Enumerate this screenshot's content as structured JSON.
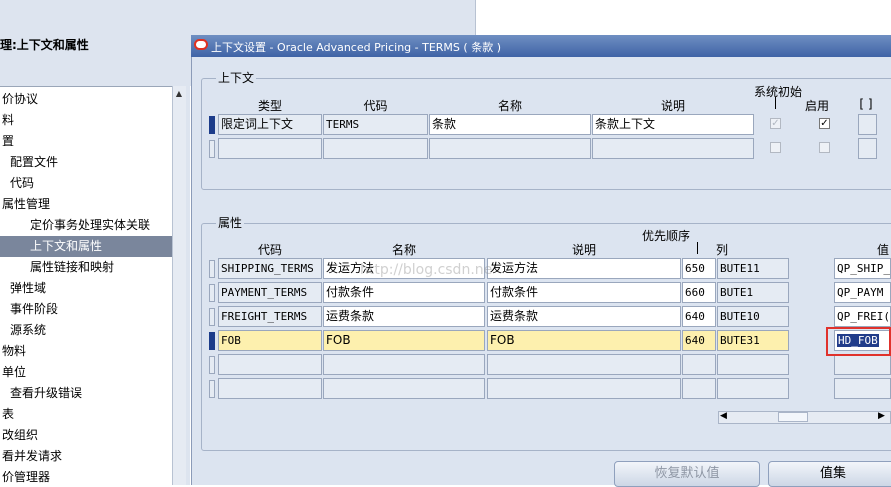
{
  "navigator": {
    "title": "理:上下文和属性",
    "items": [
      {
        "label": "价协议",
        "indent": 0
      },
      {
        "label": "料",
        "indent": 0
      },
      {
        "label": "置",
        "indent": 0
      },
      {
        "label": "配置文件",
        "indent": 1
      },
      {
        "label": "代码",
        "indent": 1
      },
      {
        "label": "属性管理",
        "indent": 0
      },
      {
        "label": "定价事务处理实体关联",
        "indent": 2
      },
      {
        "label": "上下文和属性",
        "indent": 2,
        "selected": true
      },
      {
        "label": "属性链接和映射",
        "indent": 2
      },
      {
        "label": "弹性域",
        "indent": 1
      },
      {
        "label": "事件阶段",
        "indent": 1
      },
      {
        "label": "源系统",
        "indent": 1
      },
      {
        "label": "物料",
        "indent": 0
      },
      {
        "label": "单位",
        "indent": 0
      },
      {
        "label": "查看升级错误",
        "indent": 1
      },
      {
        "label": "表",
        "indent": 0
      },
      {
        "label": "改组织",
        "indent": 0
      },
      {
        "label": "看并发请求",
        "indent": 0
      },
      {
        "label": "价管理器",
        "indent": 0
      }
    ]
  },
  "window": {
    "title": "上下文设置 - Oracle Advanced Pricing - TERMS ( 条款 )",
    "icon": "oracle-logo-icon"
  },
  "context": {
    "label": "上下文",
    "headers": {
      "type": "类型",
      "code": "代码",
      "name": "名称",
      "description": "说明",
      "system_init": "系统初始",
      "enabled": "启用",
      "bracket": "[ ]"
    },
    "row": {
      "type": "限定词上下文",
      "code": "TERMS",
      "name": "条款",
      "description": "条款上下文",
      "system_init_checked": true,
      "enabled_checked": true
    }
  },
  "attributes": {
    "label": "属性",
    "headers": {
      "code": "代码",
      "name": "名称",
      "description": "说明",
      "priority": "优先顺序",
      "attr_partial": "列",
      "value_partial": "值"
    },
    "rows": [
      {
        "code": "SHIPPING_TERMS",
        "name": "发运方法",
        "description": "发运方法",
        "priority": "650",
        "column": "BUTE11",
        "value": "QP_SHIP_"
      },
      {
        "code": "PAYMENT_TERMS",
        "name": "付款条件",
        "description": "付款条件",
        "priority": "660",
        "column": "BUTE1",
        "value": "QP_PAYM"
      },
      {
        "code": "FREIGHT_TERMS",
        "name": "运费条款",
        "description": "运费条款",
        "priority": "640",
        "column": "BUTE10",
        "value": "QP_FREI("
      },
      {
        "code": "FOB",
        "name": "FOB",
        "description": "FOB",
        "priority": "640",
        "column": "BUTE31",
        "value": "HD_FOB"
      }
    ]
  },
  "buttons": {
    "restore_defaults": "恢复默认值",
    "value_set": "值集"
  },
  "watermark": "http://blog.csdn.ne",
  "colors": {
    "title_bar": "#3f63a6",
    "highlight_row": "#fdf0ae",
    "selection_box": "#e0322c",
    "selected_nav": "#7a869c"
  }
}
